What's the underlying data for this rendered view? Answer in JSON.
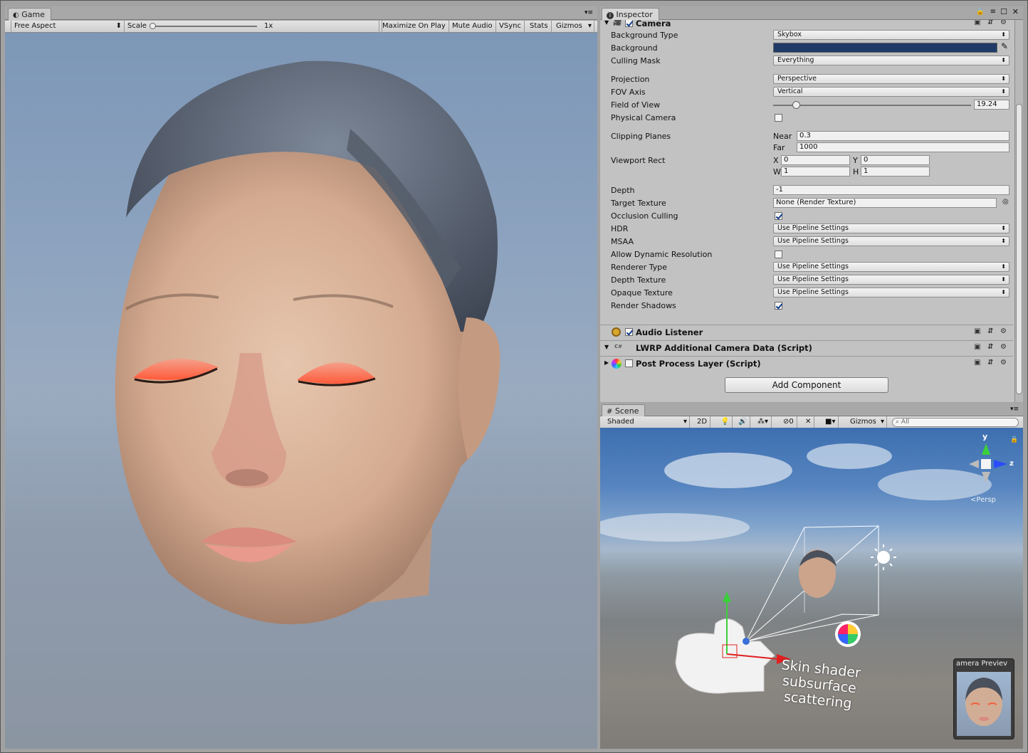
{
  "game": {
    "tab": "Game",
    "aspect": "Free Aspect",
    "scale_label": "Scale",
    "scale_value": "1x",
    "buttons": [
      "Maximize On Play",
      "Mute Audio",
      "VSync",
      "Stats",
      "Gizmos"
    ]
  },
  "inspector": {
    "tab": "Inspector",
    "camera": {
      "title": "Camera",
      "background_type": {
        "label": "Background Type",
        "value": "Skybox"
      },
      "background": {
        "label": "Background",
        "color": "#1f3a66"
      },
      "culling_mask": {
        "label": "Culling Mask",
        "value": "Everything"
      },
      "projection": {
        "label": "Projection",
        "value": "Perspective"
      },
      "fov_axis": {
        "label": "FOV Axis",
        "value": "Vertical"
      },
      "field_of_view": {
        "label": "Field of View",
        "value": "19.24",
        "fraction": 0.12
      },
      "physical_camera": {
        "label": "Physical Camera",
        "checked": false
      },
      "clipping": {
        "label": "Clipping Planes",
        "near_label": "Near",
        "near": "0.3",
        "far_label": "Far",
        "far": "1000"
      },
      "viewport": {
        "label": "Viewport Rect",
        "x_label": "X",
        "x": "0",
        "y_label": "Y",
        "y": "0",
        "w_label": "W",
        "w": "1",
        "h_label": "H",
        "h": "1"
      },
      "depth": {
        "label": "Depth",
        "value": "-1"
      },
      "target_texture": {
        "label": "Target Texture",
        "value": "None (Render Texture)"
      },
      "occlusion_culling": {
        "label": "Occlusion Culling",
        "checked": true
      },
      "hdr": {
        "label": "HDR",
        "value": "Use Pipeline Settings"
      },
      "msaa": {
        "label": "MSAA",
        "value": "Use Pipeline Settings"
      },
      "dynamic_res": {
        "label": "Allow Dynamic Resolution",
        "checked": false
      },
      "renderer_type": {
        "label": "Renderer Type",
        "value": "Use Pipeline Settings"
      },
      "depth_texture": {
        "label": "Depth Texture",
        "value": "Use Pipeline Settings"
      },
      "opaque_texture": {
        "label": "Opaque Texture",
        "value": "Use Pipeline Settings"
      },
      "render_shadows": {
        "label": "Render Shadows",
        "checked": true
      }
    },
    "components": [
      "Audio Listener",
      "LWRP Additional Camera Data (Script)",
      "Post Process Layer (Script)"
    ],
    "add_component": "Add Component"
  },
  "scene": {
    "tab": "Scene",
    "shading": "Shaded",
    "mode_2d": "2D",
    "hidden_count": "0",
    "gizmos": "Gizmos",
    "search_placeholder": "All",
    "axis_y": "y",
    "axis_z": "z",
    "persp": "Persp",
    "label_lines": [
      "Skin shader",
      "subsurface",
      "scattering"
    ],
    "camera_preview": "amera Previev"
  },
  "colors": {
    "accent": "#3a6fd8",
    "skin": "#d9b59c",
    "axis_y": "#3ccf3c",
    "axis_z": "#2a4cff",
    "axis_x": "#e02020"
  }
}
